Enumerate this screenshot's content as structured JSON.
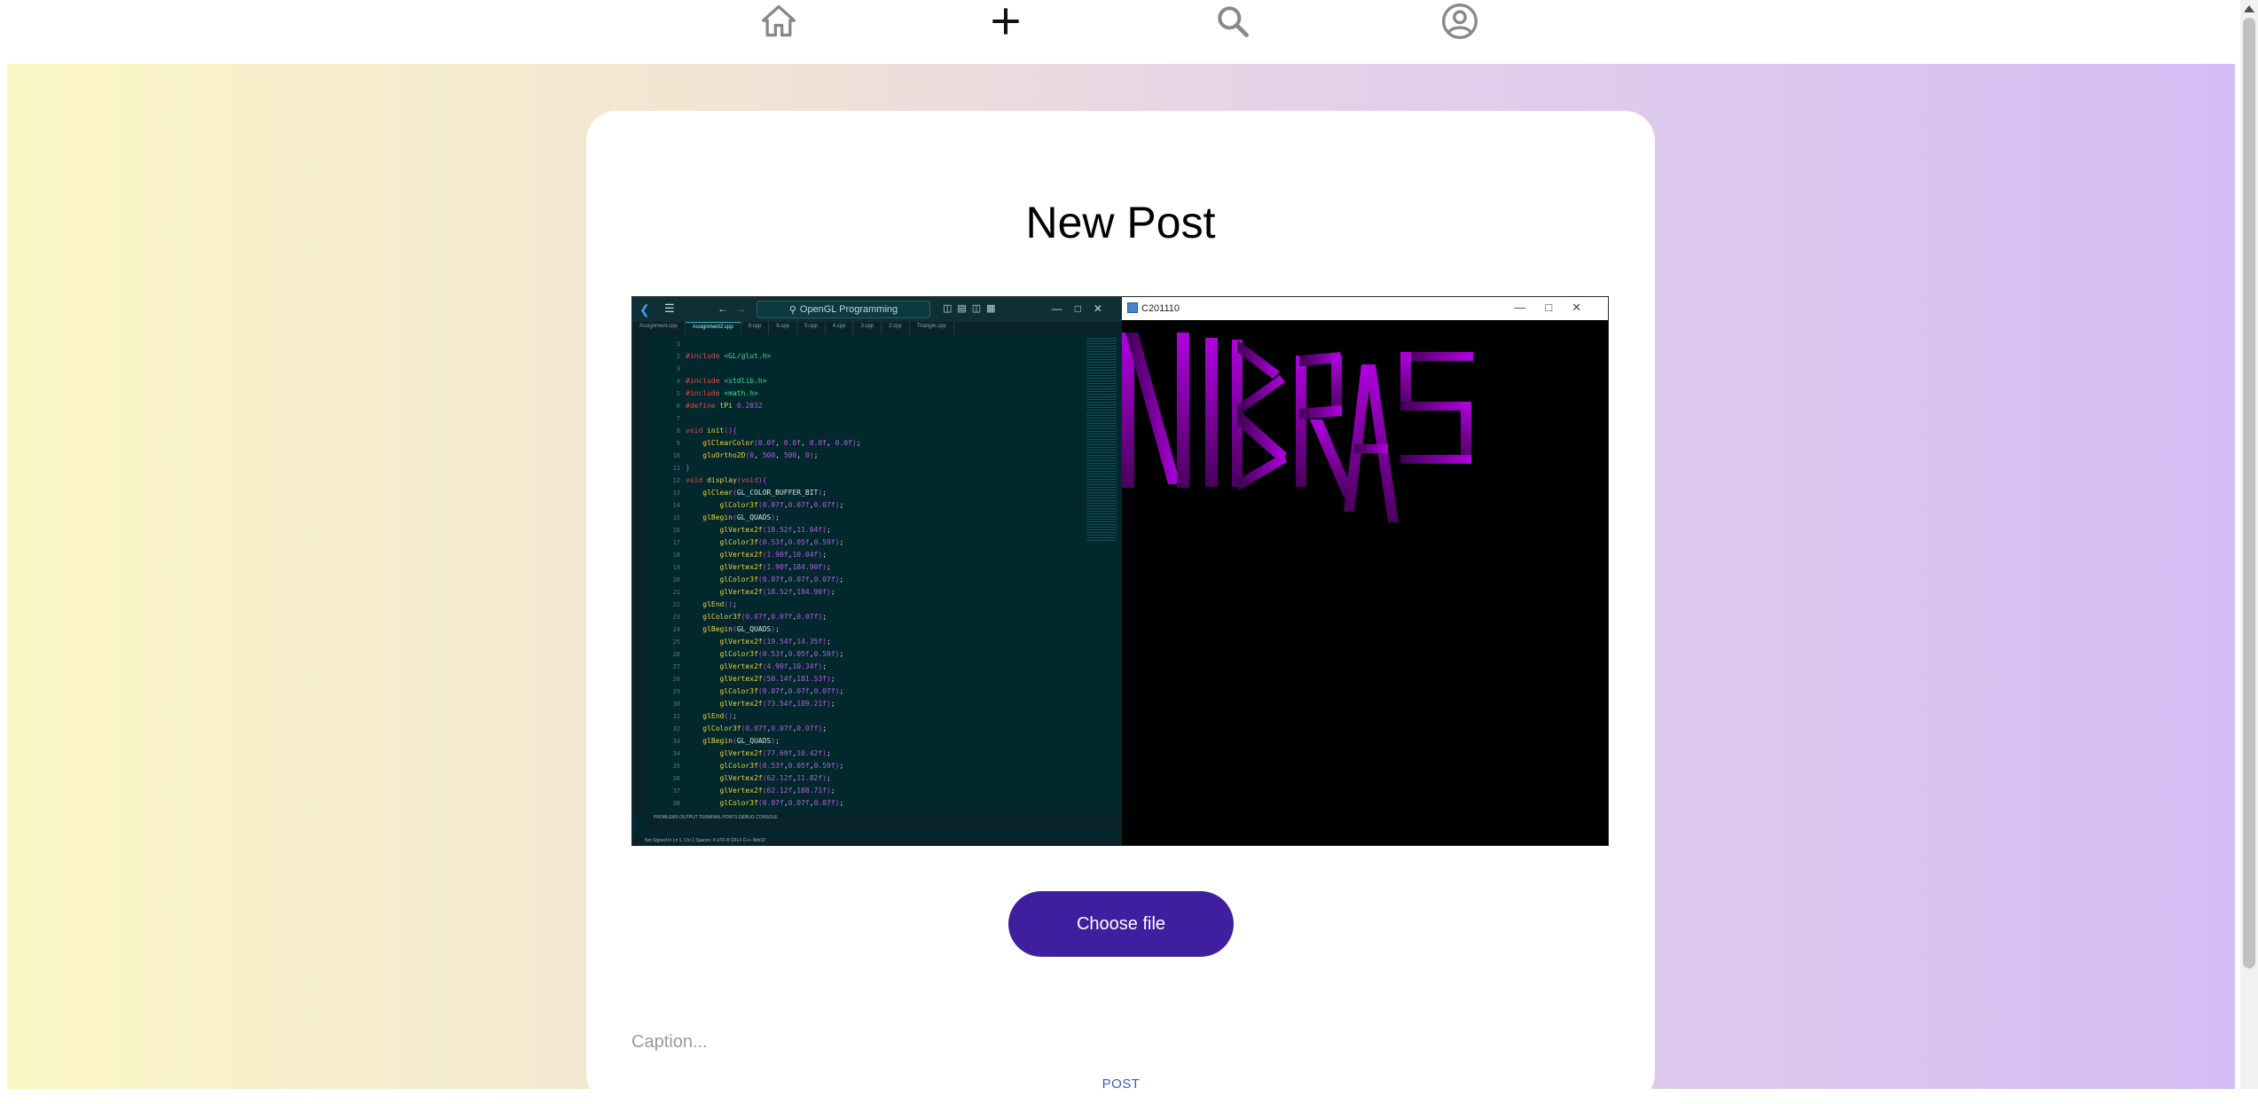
{
  "nav": {
    "items": [
      {
        "icon": "home-icon"
      },
      {
        "icon": "plus-icon"
      },
      {
        "icon": "search-icon"
      },
      {
        "icon": "account-circle-icon"
      }
    ]
  },
  "page": {
    "title": "New Post"
  },
  "preview": {
    "editor": {
      "search_label": "OpenGL Programming",
      "tabs": [
        "Assignment.cpp",
        "Assignment2.cpp",
        "8.cpp",
        "6.cpp",
        "5.cpp",
        "4.cpp",
        "3.cpp",
        "2.cpp",
        "Triangle.cpp"
      ],
      "code_lines": [
        "",
        "#include <GL/glut.h>",
        "",
        "#include <stdlib.h>",
        "#include <math.h>",
        "#define tPi 6.2832",
        "",
        "void init(){",
        "    glClearColor(0.0f, 0.0f, 0.0f, 0.0f);",
        "    gluOrtho2D(0, 500, 500, 0);",
        "}",
        "void display(void){",
        "    glClear(GL_COLOR_BUFFER_BIT);",
        "        glColor3f(0.07f,0.07f,0.07f);",
        "    glBegin(GL_QUADS);",
        "        glVertex2f(18.52f,11.04f);",
        "        glColor3f(0.53f,0.05f,0.59f);",
        "        glVertex2f(1.90f,10.04f);",
        "        glVertex2f(1.90f,184.90f);",
        "        glColor3f(0.07f,0.07f,0.07f);",
        "        glVertex2f(18.52f,184.90f);",
        "    glEnd();",
        "    glColor3f(0.07f,0.07f,0.07f);",
        "    glBegin(GL_QUADS);",
        "        glVertex2f(19.54f,14.35f);",
        "        glColor3f(0.53f,0.05f,0.59f);",
        "        glVertex2f(4.90f,10.34f);",
        "        glVertex2f(50.14f,181.53f);",
        "        glColor3f(0.07f,0.07f,0.07f);",
        "        glVertex2f(73.54f,189.21f);",
        "    glEnd();",
        "    glColor3f(0.07f,0.07f,0.07f);",
        "    glBegin(GL_QUADS);",
        "        glVertex2f(77.69f,10.42f);",
        "        glColor3f(0.53f,0.05f,0.59f);",
        "        glVertex2f(62.12f,11.82f);",
        "        glVertex2f(62.12f,188.71f);",
        "        glColor3f(0.07f,0.07f,0.07f);"
      ],
      "panel_tabs": "PROBLEMS   OUTPUT   TERMINAL   PORTS   DEBUG CONSOLE",
      "status_text": "Not Signed In   Ln 1, Col 1   Spaces: 4   UTF-8   CRLF   C++   Win32"
    },
    "glwindow": {
      "title": "C201110",
      "rendered_text": "NIBRAS",
      "colors": {
        "bright": "#a600d6",
        "dark": "#3a0048",
        "background": "#000000"
      }
    }
  },
  "actions": {
    "choose_file_label": "Choose file",
    "caption_placeholder": "Caption...",
    "post_label": "POST"
  },
  "colors": {
    "accent": "#3f1fa0",
    "post_link": "#3b59c2",
    "gradient_start": "#fbf6c6",
    "gradient_end": "#d6bcf4"
  }
}
